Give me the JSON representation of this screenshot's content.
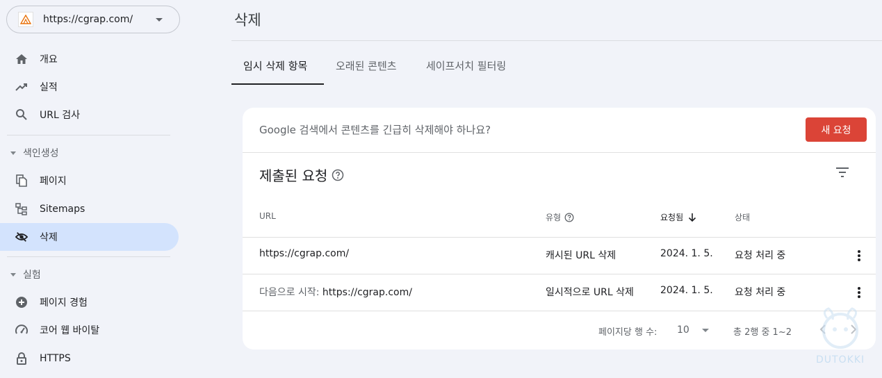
{
  "property": {
    "url": "https://cgrap.com/"
  },
  "sidebar": {
    "items": [
      {
        "label": "개요",
        "icon": "home-icon"
      },
      {
        "label": "실적",
        "icon": "trending-up-icon"
      },
      {
        "label": "URL 검사",
        "icon": "search-icon"
      }
    ],
    "sections": [
      {
        "title": "색인생성",
        "items": [
          {
            "label": "페이지",
            "icon": "pages-icon"
          },
          {
            "label": "Sitemaps",
            "icon": "sitemap-icon"
          },
          {
            "label": "삭제",
            "icon": "visibility-off-icon",
            "active": true
          }
        ]
      },
      {
        "title": "실험",
        "items": [
          {
            "label": "페이지 경험",
            "icon": "add-circle-icon"
          },
          {
            "label": "코어 웹 바이탈",
            "icon": "speed-icon"
          },
          {
            "label": "HTTPS",
            "icon": "lock-icon"
          }
        ]
      }
    ]
  },
  "page": {
    "title": "삭제"
  },
  "tabs": [
    {
      "label": "임시 삭제 항목",
      "active": true
    },
    {
      "label": "오래된 콘텐츠"
    },
    {
      "label": "세이프서치 필터링"
    }
  ],
  "card": {
    "question": "Google 검색에서 콘텐츠를 긴급히 삭제해야 하나요?",
    "new_request_label": "새 요청",
    "section_title": "제출된 요청",
    "columns": {
      "url": "URL",
      "type": "유형",
      "requested": "요청됨",
      "status": "상태"
    },
    "rows": [
      {
        "url_prefix": "",
        "url": "https://cgrap.com/",
        "type": "캐시된 URL 삭제",
        "date": "2024. 1. 5.",
        "status": "요청 처리 중"
      },
      {
        "url_prefix": "다음으로 시작: ",
        "url": "https://cgrap.com/",
        "type": "일시적으로 URL 삭제",
        "date": "2024. 1. 5.",
        "status": "요청 처리 중"
      }
    ],
    "pagination": {
      "rows_per_page_label": "페이지당 행 수:",
      "rows_per_page": "10",
      "range": "총 2행 중 1~2"
    }
  },
  "watermark": "DUTOKKI",
  "colors": {
    "accent_red": "#db4437",
    "active_nav": "#d3e3fd",
    "background": "#f1f3f9"
  }
}
